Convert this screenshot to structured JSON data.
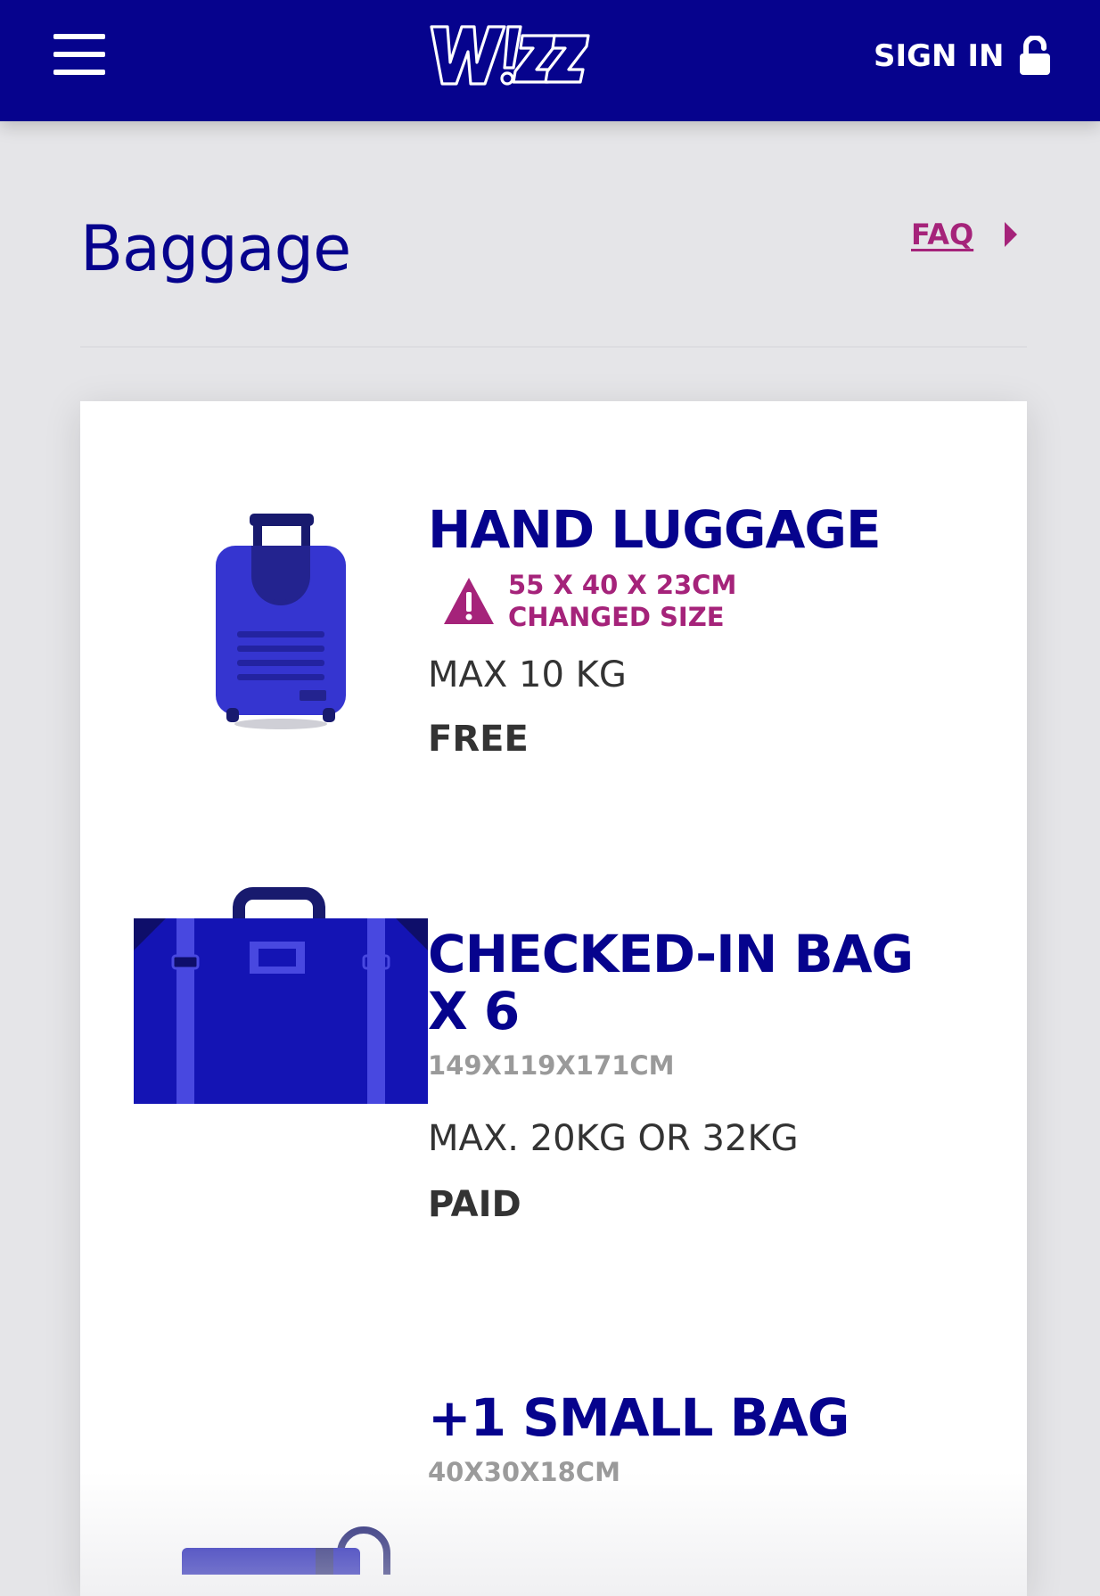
{
  "header": {
    "logo_text": "W!ZZ",
    "menu_icon": "hamburger-menu-icon",
    "signin_label": "SIGN IN",
    "signin_icon": "unlocked-padlock-icon",
    "background_color": "#06038d"
  },
  "page": {
    "title": "Baggage",
    "faq_label": "FAQ",
    "faq_icon": "caret-right-icon"
  },
  "colors": {
    "brand_blue": "#06038d",
    "accent_magenta": "#a5237a",
    "text_dark": "#333333",
    "text_muted": "#9a9a9a"
  },
  "baggage": {
    "hand": {
      "title": "HAND LUGGAGE",
      "icon": "trolley-suitcase-icon",
      "warning_icon": "warning-triangle-icon",
      "dimensions": "55 X 40 X 23CM",
      "warning": "CHANGED SIZE",
      "weight": "MAX 10 KG",
      "price": "FREE"
    },
    "checked": {
      "title_line1": "CHECKED-IN BAG",
      "title_line2": "X 6",
      "icon": "checked-suitcase-icon",
      "dimensions": "149X119X171CM",
      "weight": "MAX. 20KG OR 32KG",
      "price": "PAID"
    },
    "small": {
      "title": "+1 SMALL BAG",
      "icon": "small-bag-icon",
      "dimensions": "40X30X18CM"
    }
  }
}
